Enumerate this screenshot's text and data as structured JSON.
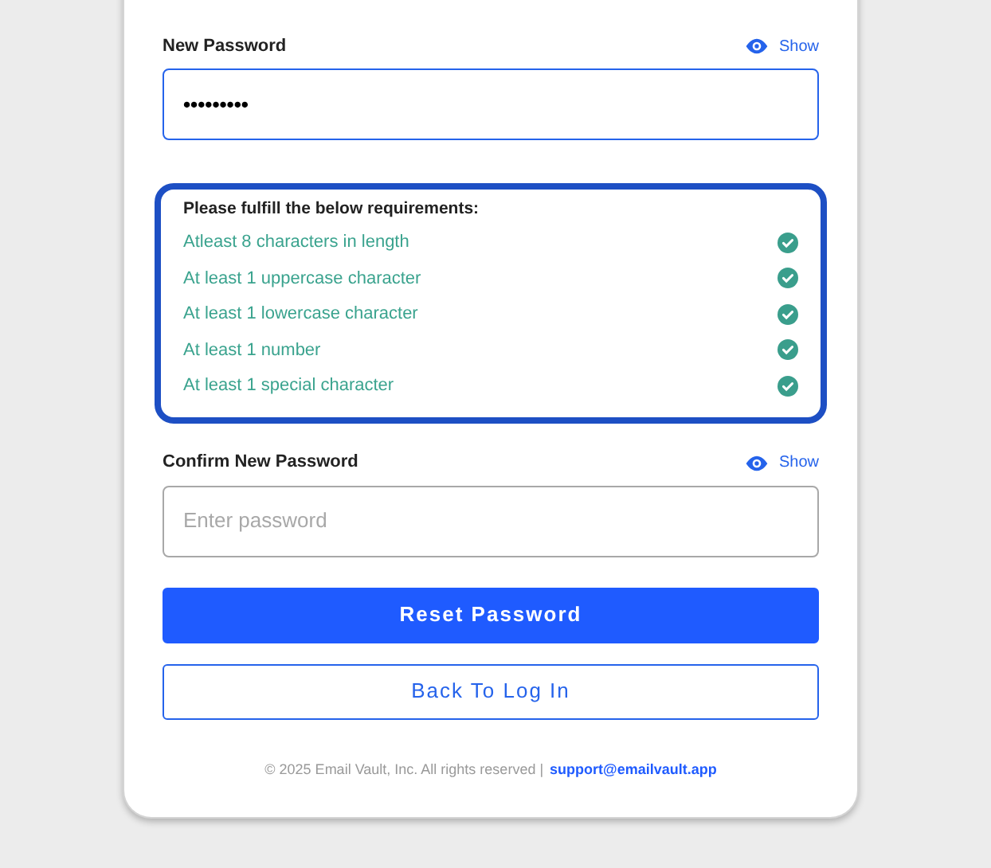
{
  "new_password": {
    "label": "New Password",
    "toggle": "Show",
    "value": "•••••••••",
    "focused": true
  },
  "requirements": {
    "title": "Please fulfill the below requirements:",
    "items": [
      {
        "text": "Atleast 8 characters in length",
        "met": true
      },
      {
        "text": "At least 1 uppercase character",
        "met": true
      },
      {
        "text": "At least 1 lowercase character",
        "met": true
      },
      {
        "text": "At least 1 number",
        "met": true
      },
      {
        "text": "At least 1 special character",
        "met": true
      }
    ]
  },
  "confirm_password": {
    "label": "Confirm New Password",
    "toggle": "Show",
    "placeholder": "Enter password",
    "focused": false
  },
  "buttons": [
    {
      "kind": "primary",
      "label": "Reset Password"
    },
    {
      "kind": "outline",
      "label": "Back To Log In"
    }
  ],
  "footer": {
    "text": "© 2025 Email Vault, Inc. All rights reserved |",
    "link": "support@emailvault.app"
  }
}
